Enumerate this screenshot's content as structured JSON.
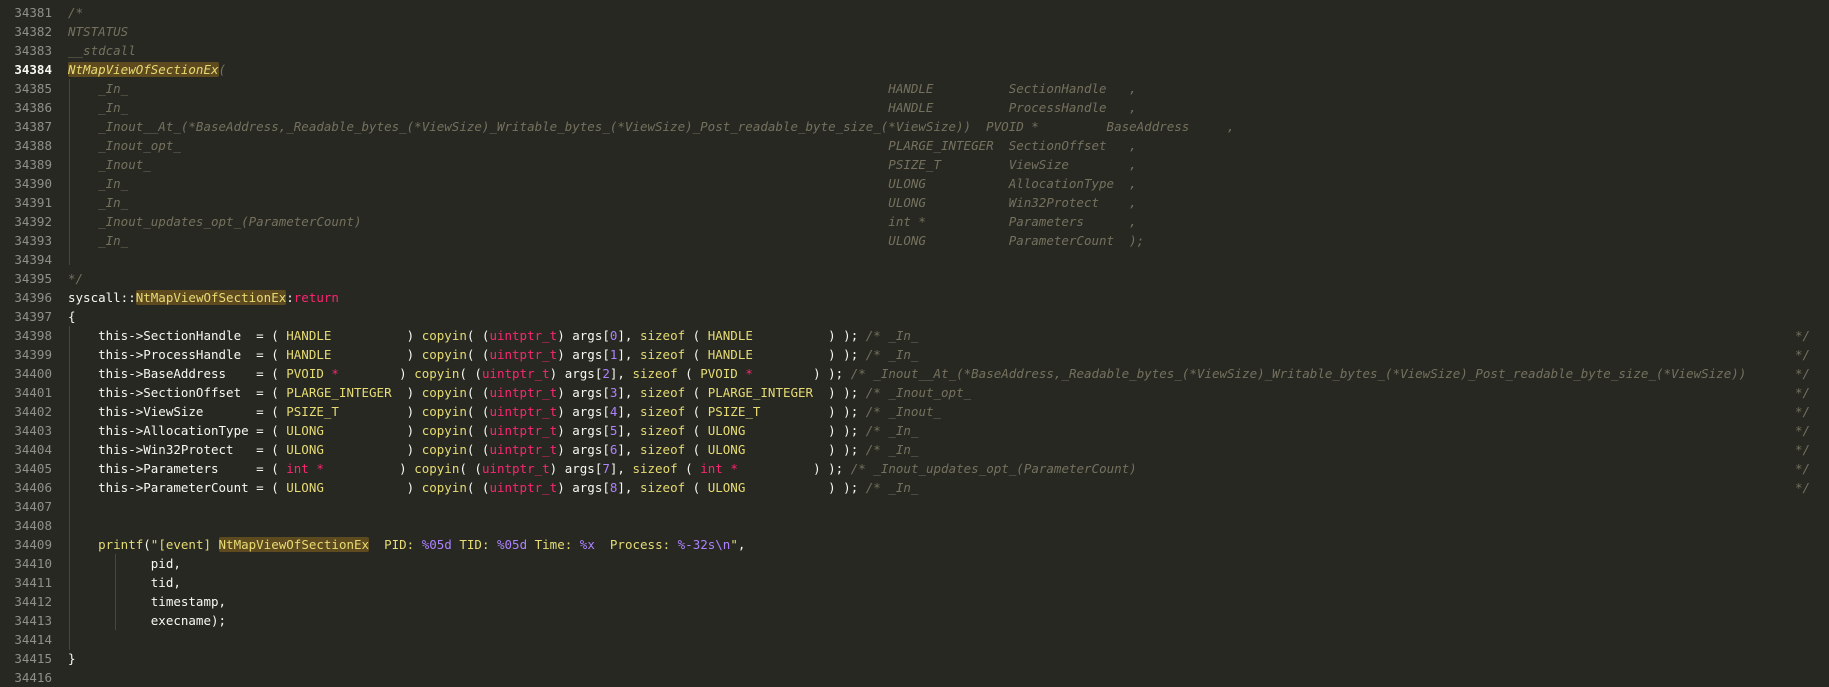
{
  "editor": {
    "lines": [
      {
        "n": "34381",
        "segs": [
          [
            "c",
            "/*"
          ]
        ]
      },
      {
        "n": "34382",
        "segs": [
          [
            "c",
            "NTSTATUS"
          ]
        ]
      },
      {
        "n": "34383",
        "segs": [
          [
            "c",
            "__stdcall"
          ]
        ]
      },
      {
        "n": "34384",
        "segs": [
          [
            "chl",
            "NtMapViewOfSectionEx"
          ],
          [
            "c",
            "("
          ]
        ],
        "active": true
      },
      {
        "n": "34385",
        "segs": [
          [
            "c",
            "    _In_                                                                                                     HANDLE          SectionHandle   ,"
          ]
        ]
      },
      {
        "n": "34386",
        "segs": [
          [
            "c",
            "    _In_                                                                                                     HANDLE          ProcessHandle   ,"
          ]
        ]
      },
      {
        "n": "34387",
        "segs": [
          [
            "c",
            "    _Inout__At_(*BaseAddress,_Readable_bytes_(*ViewSize)_Writable_bytes_(*ViewSize)_Post_readable_byte_size_(*ViewSize))  PVOID *         BaseAddress     ,"
          ]
        ]
      },
      {
        "n": "34388",
        "segs": [
          [
            "c",
            "    _Inout_opt_                                                                                              PLARGE_INTEGER  SectionOffset   ,"
          ]
        ]
      },
      {
        "n": "34389",
        "segs": [
          [
            "c",
            "    _Inout_                                                                                                  PSIZE_T         ViewSize        ,"
          ]
        ]
      },
      {
        "n": "34390",
        "segs": [
          [
            "c",
            "    _In_                                                                                                     ULONG           AllocationType  ,"
          ]
        ]
      },
      {
        "n": "34391",
        "segs": [
          [
            "c",
            "    _In_                                                                                                     ULONG           Win32Protect    ,"
          ]
        ]
      },
      {
        "n": "34392",
        "segs": [
          [
            "c",
            "    _Inout_updates_opt_(ParameterCount)                                                                      int *           Parameters      ,"
          ]
        ]
      },
      {
        "n": "34393",
        "segs": [
          [
            "c",
            "    _In_                                                                                                     ULONG           ParameterCount  );"
          ]
        ]
      },
      {
        "n": "34394",
        "segs": []
      },
      {
        "n": "34395",
        "segs": [
          [
            "c",
            "*/"
          ]
        ]
      },
      {
        "n": "34396",
        "segs": [
          [
            "p",
            "syscall::"
          ],
          [
            "hl",
            "NtMapViewOfSectionEx"
          ],
          [
            "p",
            ":"
          ],
          [
            "kw",
            "return"
          ]
        ]
      },
      {
        "n": "34397",
        "segs": [
          [
            "p",
            "{"
          ]
        ]
      },
      {
        "n": "34398",
        "segs": [
          [
            "p",
            "    this->SectionHandle  = ( "
          ],
          [
            "y",
            "HANDLE         "
          ],
          [
            "p",
            " ) "
          ],
          [
            "y",
            "copyin"
          ],
          [
            "p",
            "( ("
          ],
          [
            "kw",
            "uintptr_t"
          ],
          [
            "p",
            ") args["
          ],
          [
            "num",
            "0"
          ],
          [
            "p",
            "], "
          ],
          [
            "y",
            "sizeof"
          ],
          [
            "p",
            " ( "
          ],
          [
            "y",
            "HANDLE         "
          ],
          [
            "p",
            " ) ); "
          ],
          [
            "c",
            "/* _In_"
          ]
        ],
        "end": true
      },
      {
        "n": "34399",
        "segs": [
          [
            "p",
            "    this->ProcessHandle  = ( "
          ],
          [
            "y",
            "HANDLE         "
          ],
          [
            "p",
            " ) "
          ],
          [
            "y",
            "copyin"
          ],
          [
            "p",
            "( ("
          ],
          [
            "kw",
            "uintptr_t"
          ],
          [
            "p",
            ") args["
          ],
          [
            "num",
            "1"
          ],
          [
            "p",
            "], "
          ],
          [
            "y",
            "sizeof"
          ],
          [
            "p",
            " ( "
          ],
          [
            "y",
            "HANDLE         "
          ],
          [
            "p",
            " ) ); "
          ],
          [
            "c",
            "/* _In_"
          ]
        ],
        "end": true
      },
      {
        "n": "34400",
        "segs": [
          [
            "p",
            "    this->BaseAddress    = ( "
          ],
          [
            "y",
            "PVOID "
          ],
          [
            "kw",
            "*"
          ],
          [
            "p",
            "        ) "
          ],
          [
            "y",
            "copyin"
          ],
          [
            "p",
            "( ("
          ],
          [
            "kw",
            "uintptr_t"
          ],
          [
            "p",
            ") args["
          ],
          [
            "num",
            "2"
          ],
          [
            "p",
            "], "
          ],
          [
            "y",
            "sizeof"
          ],
          [
            "p",
            " ( "
          ],
          [
            "y",
            "PVOID "
          ],
          [
            "kw",
            "*"
          ],
          [
            "p",
            "        ) ); "
          ],
          [
            "c",
            "/* _Inout__At_(*BaseAddress,_Readable_bytes_(*ViewSize)_Writable_bytes_(*ViewSize)_Post_readable_byte_size_(*ViewSize))"
          ]
        ],
        "end": true
      },
      {
        "n": "34401",
        "segs": [
          [
            "p",
            "    this->SectionOffset  = ( "
          ],
          [
            "y",
            "PLARGE_INTEGER "
          ],
          [
            "p",
            " ) "
          ],
          [
            "y",
            "copyin"
          ],
          [
            "p",
            "( ("
          ],
          [
            "kw",
            "uintptr_t"
          ],
          [
            "p",
            ") args["
          ],
          [
            "num",
            "3"
          ],
          [
            "p",
            "], "
          ],
          [
            "y",
            "sizeof"
          ],
          [
            "p",
            " ( "
          ],
          [
            "y",
            "PLARGE_INTEGER "
          ],
          [
            "p",
            " ) ); "
          ],
          [
            "c",
            "/* _Inout_opt_"
          ]
        ],
        "end": true
      },
      {
        "n": "34402",
        "segs": [
          [
            "p",
            "    this->ViewSize       = ( "
          ],
          [
            "y",
            "PSIZE_T        "
          ],
          [
            "p",
            " ) "
          ],
          [
            "y",
            "copyin"
          ],
          [
            "p",
            "( ("
          ],
          [
            "kw",
            "uintptr_t"
          ],
          [
            "p",
            ") args["
          ],
          [
            "num",
            "4"
          ],
          [
            "p",
            "], "
          ],
          [
            "y",
            "sizeof"
          ],
          [
            "p",
            " ( "
          ],
          [
            "y",
            "PSIZE_T        "
          ],
          [
            "p",
            " ) ); "
          ],
          [
            "c",
            "/* _Inout_"
          ]
        ],
        "end": true
      },
      {
        "n": "34403",
        "segs": [
          [
            "p",
            "    this->AllocationType = ( "
          ],
          [
            "y",
            "ULONG          "
          ],
          [
            "p",
            " ) "
          ],
          [
            "y",
            "copyin"
          ],
          [
            "p",
            "( ("
          ],
          [
            "kw",
            "uintptr_t"
          ],
          [
            "p",
            ") args["
          ],
          [
            "num",
            "5"
          ],
          [
            "p",
            "], "
          ],
          [
            "y",
            "sizeof"
          ],
          [
            "p",
            " ( "
          ],
          [
            "y",
            "ULONG          "
          ],
          [
            "p",
            " ) ); "
          ],
          [
            "c",
            "/* _In_"
          ]
        ],
        "end": true
      },
      {
        "n": "34404",
        "segs": [
          [
            "p",
            "    this->Win32Protect   = ( "
          ],
          [
            "y",
            "ULONG          "
          ],
          [
            "p",
            " ) "
          ],
          [
            "y",
            "copyin"
          ],
          [
            "p",
            "( ("
          ],
          [
            "kw",
            "uintptr_t"
          ],
          [
            "p",
            ") args["
          ],
          [
            "num",
            "6"
          ],
          [
            "p",
            "], "
          ],
          [
            "y",
            "sizeof"
          ],
          [
            "p",
            " ( "
          ],
          [
            "y",
            "ULONG          "
          ],
          [
            "p",
            " ) ); "
          ],
          [
            "c",
            "/* _In_"
          ]
        ],
        "end": true
      },
      {
        "n": "34405",
        "segs": [
          [
            "p",
            "    this->Parameters     = ( "
          ],
          [
            "kw",
            "int"
          ],
          [
            "p",
            " "
          ],
          [
            "kw",
            "*"
          ],
          [
            "p",
            "          ) "
          ],
          [
            "y",
            "copyin"
          ],
          [
            "p",
            "( ("
          ],
          [
            "kw",
            "uintptr_t"
          ],
          [
            "p",
            ") args["
          ],
          [
            "num",
            "7"
          ],
          [
            "p",
            "], "
          ],
          [
            "y",
            "sizeof"
          ],
          [
            "p",
            " ( "
          ],
          [
            "kw",
            "int"
          ],
          [
            "p",
            " "
          ],
          [
            "kw",
            "*"
          ],
          [
            "p",
            "          ) ); "
          ],
          [
            "c",
            "/* _Inout_updates_opt_(ParameterCount)"
          ]
        ],
        "end": true
      },
      {
        "n": "34406",
        "segs": [
          [
            "p",
            "    this->ParameterCount = ( "
          ],
          [
            "y",
            "ULONG          "
          ],
          [
            "p",
            " ) "
          ],
          [
            "y",
            "copyin"
          ],
          [
            "p",
            "( ("
          ],
          [
            "kw",
            "uintptr_t"
          ],
          [
            "p",
            ") args["
          ],
          [
            "num",
            "8"
          ],
          [
            "p",
            "], "
          ],
          [
            "y",
            "sizeof"
          ],
          [
            "p",
            " ( "
          ],
          [
            "y",
            "ULONG          "
          ],
          [
            "p",
            " ) ); "
          ],
          [
            "c",
            "/* _In_"
          ]
        ],
        "end": true
      },
      {
        "n": "34407",
        "segs": []
      },
      {
        "n": "34408",
        "segs": []
      },
      {
        "n": "34409",
        "segs": [
          [
            "p",
            "    "
          ],
          [
            "y",
            "printf"
          ],
          [
            "p",
            "("
          ],
          [
            "str",
            "\"[event] "
          ],
          [
            "hl",
            "NtMapViewOfSectionEx"
          ],
          [
            "str",
            "  PID: "
          ],
          [
            "num",
            "%05d"
          ],
          [
            "str",
            " TID: "
          ],
          [
            "num",
            "%05d"
          ],
          [
            "str",
            " Time: "
          ],
          [
            "num",
            "%x"
          ],
          [
            "str",
            "  Process: "
          ],
          [
            "num",
            "%-32s\\n"
          ],
          [
            "str",
            "\""
          ],
          [
            "p",
            ","
          ]
        ]
      },
      {
        "n": "34410",
        "segs": [
          [
            "p",
            "           pid,"
          ]
        ]
      },
      {
        "n": "34411",
        "segs": [
          [
            "p",
            "           tid,"
          ]
        ]
      },
      {
        "n": "34412",
        "segs": [
          [
            "p",
            "           timestamp,"
          ]
        ]
      },
      {
        "n": "34413",
        "segs": [
          [
            "p",
            "           execname);"
          ]
        ]
      },
      {
        "n": "34414",
        "segs": []
      },
      {
        "n": "34415",
        "segs": [
          [
            "p",
            "}"
          ]
        ]
      },
      {
        "n": "34416",
        "segs": []
      }
    ],
    "comment_end": "*/"
  }
}
